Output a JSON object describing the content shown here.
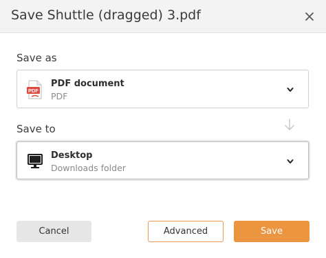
{
  "dialog": {
    "title": "Save Shuttle (dragged) 3.pdf",
    "close_icon": "close-icon"
  },
  "save_as": {
    "label": "Save as",
    "selected_title": "PDF document",
    "selected_subtitle": "PDF",
    "icon": "pdf-file-icon",
    "icon_badge": "PDF"
  },
  "save_to": {
    "label": "Save to",
    "selected_title": "Desktop",
    "selected_subtitle": "Downloads folder",
    "icon": "desktop-monitor-icon"
  },
  "buttons": {
    "cancel": "Cancel",
    "advanced": "Advanced",
    "save": "Save"
  },
  "colors": {
    "accent": "#ec9540",
    "pdf_red": "#e2483d"
  }
}
